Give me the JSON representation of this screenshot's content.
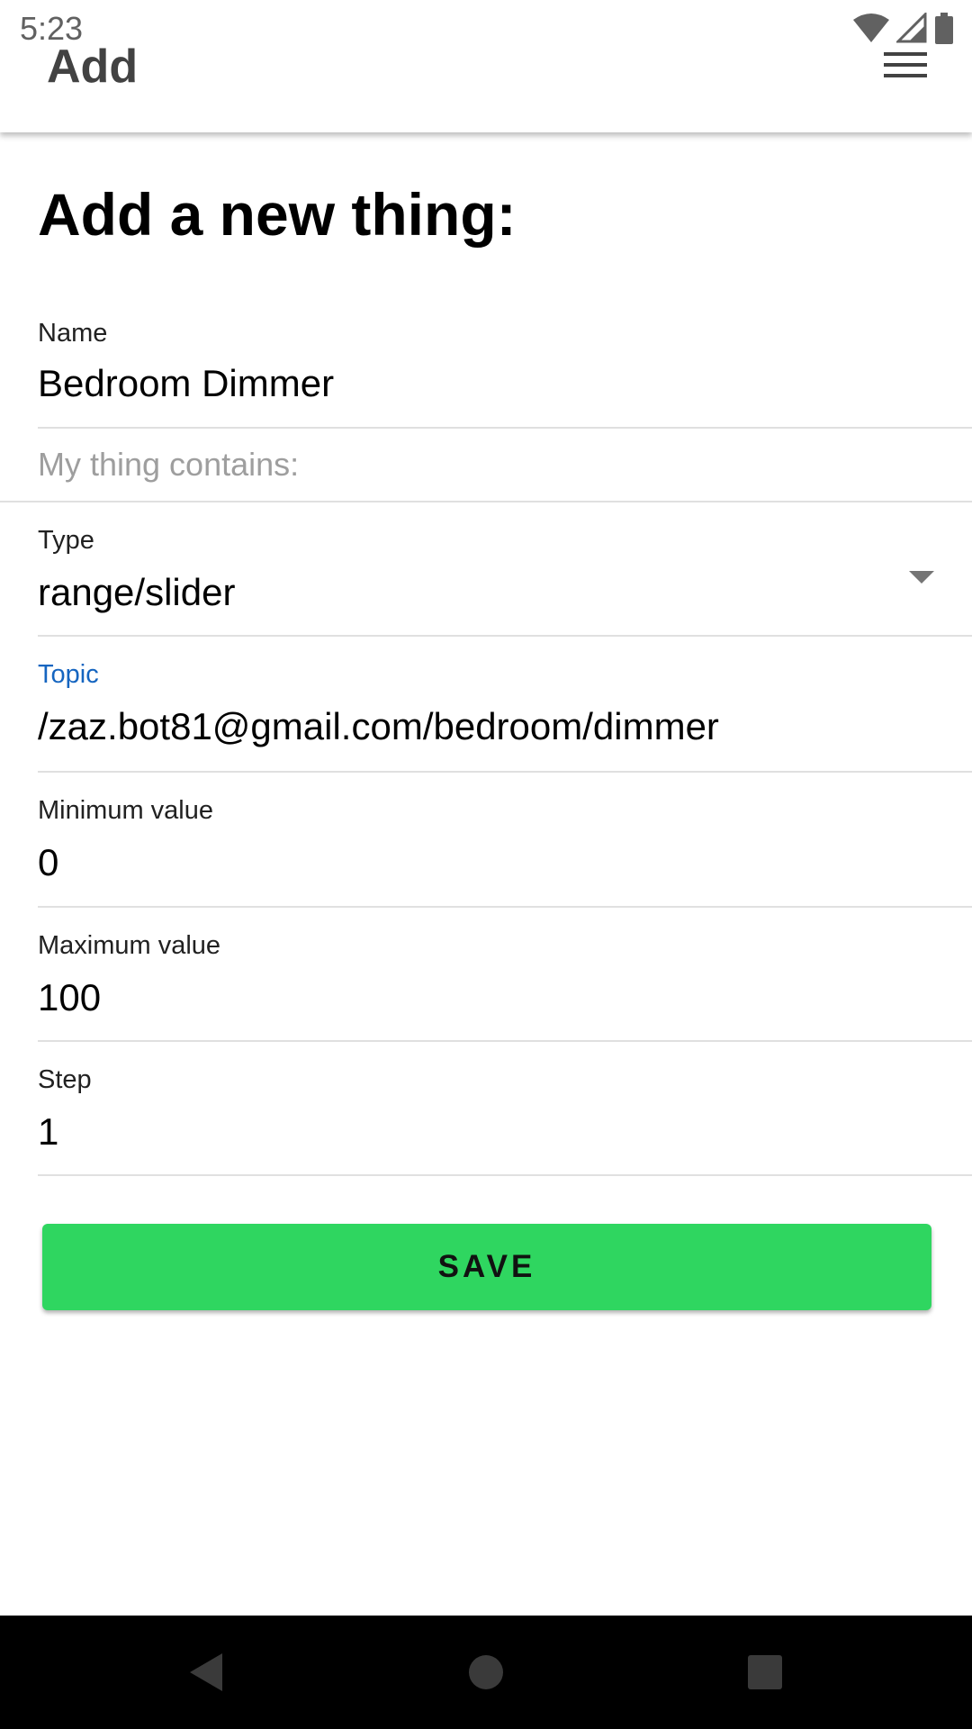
{
  "status_bar": {
    "time": "5:23",
    "icons": [
      "wifi-icon",
      "signal-icon",
      "battery-icon"
    ]
  },
  "app_bar": {
    "title": "Add",
    "menu_icon": "hamburger-menu-icon"
  },
  "form": {
    "heading": "Add a new thing:",
    "name": {
      "label": "Name",
      "value": "Bedroom Dimmer"
    },
    "contains_label": "My thing contains:",
    "type": {
      "label": "Type",
      "value": "range/slider"
    },
    "topic": {
      "label": "Topic",
      "value": "/zaz.bot81@gmail.com/bedroom/dimmer"
    },
    "min": {
      "label": "Minimum value",
      "value": "0"
    },
    "max": {
      "label": "Maximum value",
      "value": "100"
    },
    "step": {
      "label": "Step",
      "value": "1"
    },
    "save_label": "SAVE"
  },
  "nav_bar": {
    "buttons": [
      "back-icon",
      "home-icon",
      "recents-icon"
    ]
  },
  "colors": {
    "accent_focus": "#1565c0",
    "save_button": "#2fd660",
    "nav_bar": "#000000"
  }
}
